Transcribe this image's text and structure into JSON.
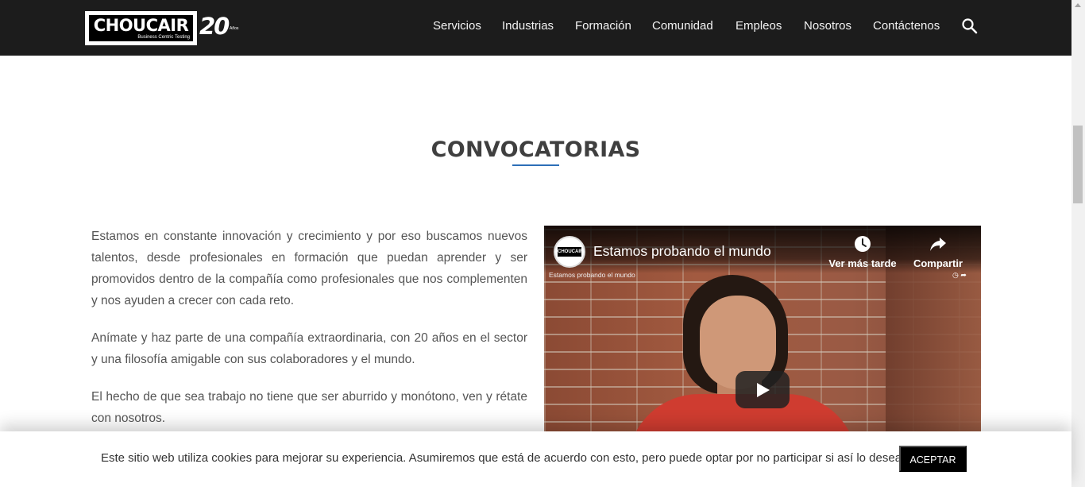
{
  "header": {
    "logo": {
      "wordmark": "CHOUCAIR",
      "tagline": "Business Centric Testing",
      "anniversary": "20",
      "anniversary_suffix": "Años"
    },
    "nav": [
      {
        "label": "Servicios"
      },
      {
        "label": "Industrias"
      },
      {
        "label": "Formación"
      },
      {
        "label": "Comunidad"
      },
      {
        "label": "Empleos"
      },
      {
        "label": "Nosotros"
      },
      {
        "label": "Contáctenos"
      }
    ],
    "search_icon": "search-icon"
  },
  "section": {
    "title": "CONVOCATORIAS",
    "accent_color": "#2d6fb7",
    "paragraphs": [
      "Estamos en constante innovación y crecimiento y por eso buscamos nuevos talentos, desde profesionales en formación que puedan aprender y ser promovidos dentro de la compañía como profesionales que nos complementen y nos ayuden a crecer con cada reto.",
      "Anímate y haz parte de una compañía extraordinaria, con 20 años en el sector y una filosofía amigable con sus colaboradores y el mundo.",
      "El hecho de que sea trabajo no tiene que ser aburrido y monótono, ven y rétate con nosotros."
    ]
  },
  "video": {
    "title": "Estamos probando el mundo",
    "subtitle": "Estamos probando el mundo",
    "channel_logo_text": "CHOUCAIR",
    "watch_later_label": "Ver más tarde",
    "share_label": "Compartir",
    "play_icon": "play-icon"
  },
  "cookie": {
    "message": "Este sitio web utiliza cookies para mejorar su experiencia. Asumiremos que está de acuerdo con esto, pero puede optar por no participar si así lo desea.",
    "accept_label": "ACEPTAR"
  }
}
